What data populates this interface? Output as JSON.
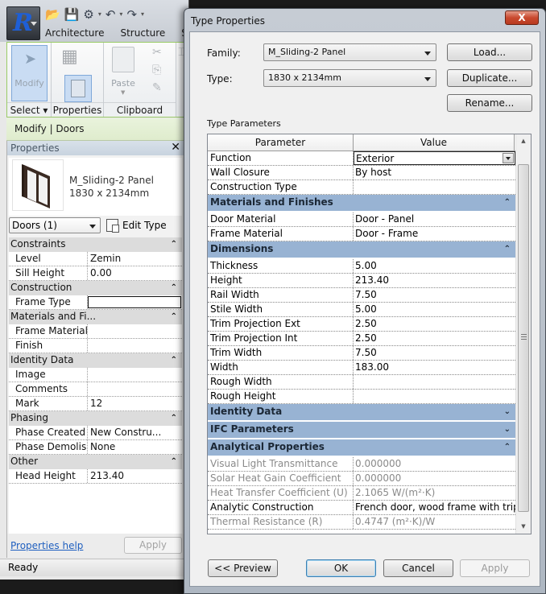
{
  "app": {
    "logo_letter": "R",
    "quick_access": [
      {
        "icon": "open-folder-icon",
        "glyph": "📂"
      },
      {
        "icon": "save-icon",
        "glyph": "💾"
      },
      {
        "icon": "sync-icon",
        "glyph": "⚙"
      },
      {
        "icon": "undo-icon",
        "glyph": "↶"
      },
      {
        "icon": "redo-icon",
        "glyph": "↷"
      }
    ],
    "ribbon_tabs": [
      "Architecture",
      "Structure",
      "Sy"
    ],
    "ribbon_groups": {
      "select": {
        "button_label": "Modify",
        "group_label": "Select ▾"
      },
      "properties": {
        "group_label": "Properties"
      },
      "clipboard": {
        "paste_label": "Paste",
        "group_label": "Clipboard"
      }
    },
    "context_tab": "Modify | Doors",
    "status": "Ready"
  },
  "properties_panel": {
    "title": "Properties",
    "close_glyph": "✕",
    "type_name_line1": "M_Sliding-2 Panel",
    "type_name_line2": "1830 x 2134mm",
    "instance_filter": "Doors (1)",
    "edit_type_label": "Edit Type",
    "groups": [
      {
        "name": "Constraints",
        "rows": [
          {
            "key": "Level",
            "value": "Zemin"
          },
          {
            "key": "Sill Height",
            "value": "0.00"
          }
        ]
      },
      {
        "name": "Construction",
        "rows": [
          {
            "key": "Frame Type",
            "value": "",
            "editing": true
          }
        ]
      },
      {
        "name": "Materials and Fi...",
        "rows": [
          {
            "key": "Frame Material",
            "value": ""
          },
          {
            "key": "Finish",
            "value": ""
          }
        ]
      },
      {
        "name": "Identity Data",
        "rows": [
          {
            "key": "Image",
            "value": ""
          },
          {
            "key": "Comments",
            "value": ""
          },
          {
            "key": "Mark",
            "value": "12"
          }
        ]
      },
      {
        "name": "Phasing",
        "rows": [
          {
            "key": "Phase Created",
            "value": "New Constru..."
          },
          {
            "key": "Phase Demolis...",
            "value": "None"
          }
        ]
      },
      {
        "name": "Other",
        "rows": [
          {
            "key": "Head Height",
            "value": "213.40"
          }
        ]
      }
    ],
    "help_link": "Properties help",
    "apply_label": "Apply"
  },
  "dialog": {
    "title": "Type Properties",
    "close_glyph": "X",
    "family_label": "Family:",
    "family_value": "M_Sliding-2 Panel",
    "type_label": "Type:",
    "type_value": "1830 x 2134mm",
    "load_label": "Load...",
    "duplicate_label": "Duplicate...",
    "rename_label": "Rename...",
    "type_parameters_label": "Type Parameters",
    "columns": {
      "parameter": "Parameter",
      "value": "Value"
    },
    "top_rows": [
      {
        "key": "Function",
        "value": "Exterior",
        "selected": true
      },
      {
        "key": "Wall Closure",
        "value": "By host"
      },
      {
        "key": "Construction Type",
        "value": ""
      }
    ],
    "materials_group": {
      "name": "Materials and Finishes",
      "state": "expanded",
      "rows": [
        {
          "key": "Door Material",
          "value": "Door - Panel"
        },
        {
          "key": "Frame Material",
          "value": "Door - Frame"
        }
      ]
    },
    "dimensions_group": {
      "name": "Dimensions",
      "state": "expanded",
      "rows": [
        {
          "key": "Thickness",
          "value": "5.00"
        },
        {
          "key": "Height",
          "value": "213.40"
        },
        {
          "key": "Rail Width",
          "value": "7.50"
        },
        {
          "key": "Stile Width",
          "value": "5.00"
        },
        {
          "key": "Trim Projection Ext",
          "value": "2.50"
        },
        {
          "key": "Trim Projection Int",
          "value": "2.50"
        },
        {
          "key": "Trim Width",
          "value": "7.50"
        },
        {
          "key": "Width",
          "value": "183.00"
        },
        {
          "key": "Rough Width",
          "value": ""
        },
        {
          "key": "Rough Height",
          "value": ""
        }
      ]
    },
    "identity_group": {
      "name": "Identity Data",
      "state": "collapsed"
    },
    "ifc_group": {
      "name": "IFC Parameters",
      "state": "collapsed"
    },
    "analytical_group": {
      "name": "Analytical Properties",
      "state": "expanded",
      "rows": [
        {
          "key": "Visual Light Transmittance",
          "value": "0.000000",
          "dim": true
        },
        {
          "key": "Solar Heat Gain Coefficient",
          "value": "0.000000",
          "dim": true
        },
        {
          "key": "Heat Transfer Coefficient (U)",
          "value": "2.1065 W/(m²·K)",
          "dim": true
        },
        {
          "key": "Analytic Construction",
          "value": "French door, wood frame with trip",
          "dim": false
        },
        {
          "key": "Thermal Resistance (R)",
          "value": "0.4747 (m²·K)/W",
          "dim": true
        }
      ]
    },
    "buttons": {
      "preview": "<< Preview",
      "ok": "OK",
      "cancel": "Cancel",
      "apply": "Apply"
    },
    "colors": {
      "group_header": "#98b3d3",
      "close_button": "#c94a2f"
    }
  }
}
